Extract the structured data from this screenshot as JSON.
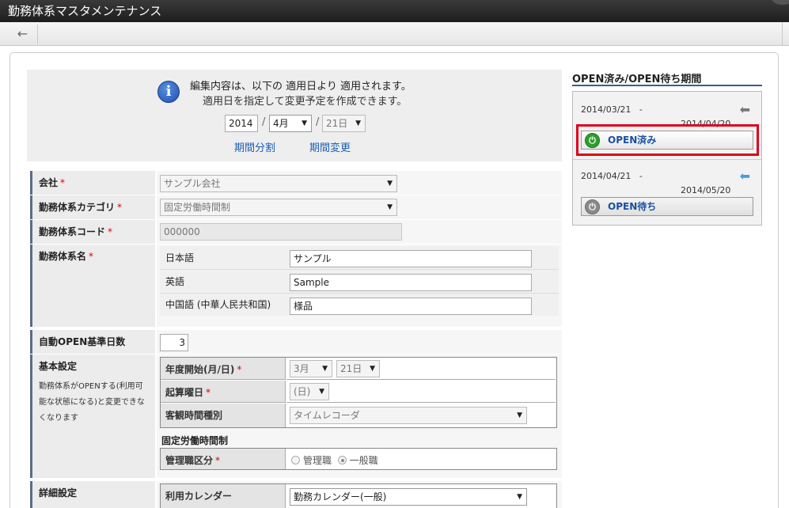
{
  "window": {
    "title": "勤務体系マスタメンテナンス"
  },
  "toolbar": {
    "back_icon": "←"
  },
  "notice": {
    "line1": "編集内容は、以下の 適用日より 適用されます。",
    "line2": "適用日を指定して変更予定を作成できます。",
    "year": "2014",
    "month": "4月",
    "day": "21日",
    "split_link": "期間分割",
    "change_link": "期間変更"
  },
  "form": {
    "company": {
      "label": "会社",
      "required": "*",
      "value": "サンプル会社"
    },
    "category": {
      "label": "勤務体系カテゴリ",
      "required": "*",
      "value": "固定労働時間制"
    },
    "code": {
      "label": "勤務体系コード",
      "required": "*",
      "value": "000000"
    },
    "name": {
      "label": "勤務体系名",
      "required": "*",
      "langs": [
        {
          "lang": "日本語",
          "value": "サンプル"
        },
        {
          "lang": "英語",
          "value": "Sample"
        },
        {
          "lang": "中国語 (中華人民共和国)",
          "value": "様品"
        }
      ]
    },
    "auto_open": {
      "label": "自動OPEN基準日数",
      "value": "3"
    },
    "basic": {
      "label": "基本設定",
      "note": "勤務体系がOPENする(利用可能な状態になる)と変更できなくなります",
      "fiscal_start": {
        "label": "年度開始(月/日)",
        "required": "*",
        "month": "3月",
        "day": "21日"
      },
      "week_start": {
        "label": "起算曜日",
        "required": "*",
        "value": "(日)"
      },
      "obj_time": {
        "label": "客観時間種別",
        "value": "タイムレコーダ"
      },
      "fixed_heading": "固定労働時間制",
      "manager": {
        "label": "管理職区分",
        "required": "*",
        "opt1": "管理職",
        "opt2": "一般職"
      }
    },
    "detail": {
      "label": "詳細設定",
      "calendar": {
        "label": "利用カレンダー",
        "value": "勤務カレンダー(一般)"
      }
    }
  },
  "side": {
    "title": "OPEN済み/OPEN待ち期間",
    "periods": [
      {
        "start": "2014/03/21",
        "dash": "-",
        "end": "2014/04/20",
        "status": "OPEN済み",
        "arrow": "⬅"
      },
      {
        "start": "2014/04/21",
        "dash": "-",
        "end": "2014/05/20",
        "status": "OPEN待ち",
        "arrow": "⬅"
      }
    ]
  },
  "colors": {
    "highlight": "#e0001a",
    "link": "#1a5fb4",
    "open_done": "#2e9e2e",
    "open_wait": "#8a8a8a",
    "arrow_active": "#4a9ad8"
  }
}
